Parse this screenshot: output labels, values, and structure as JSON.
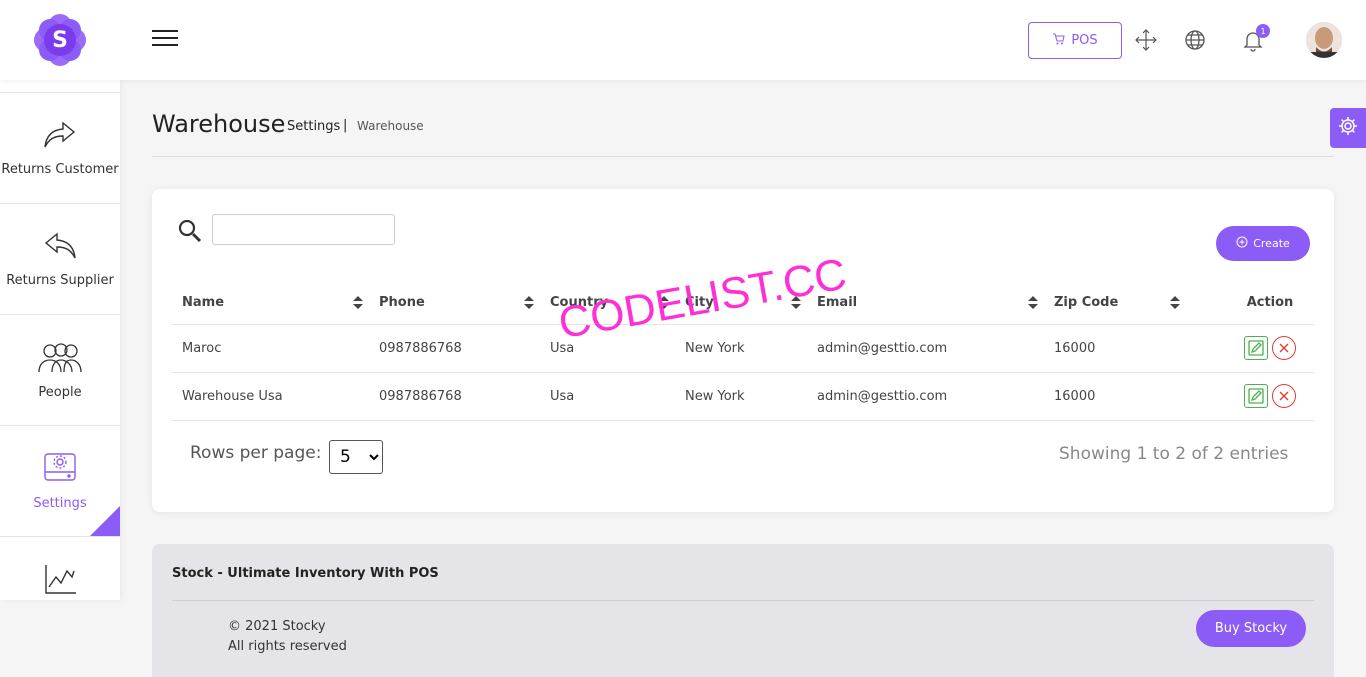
{
  "header": {
    "logo_letter": "S",
    "pos_label": "POS",
    "notification_count": "1"
  },
  "sidebar": {
    "items": [
      {
        "label": "Returns Customer",
        "icon": "share-forward-icon"
      },
      {
        "label": "Returns Supplier",
        "icon": "reply-back-icon"
      },
      {
        "label": "People",
        "icon": "people-icon"
      },
      {
        "label": "Settings",
        "icon": "settings-drive-icon",
        "active": true
      },
      {
        "label": "",
        "icon": "chart-line-icon"
      }
    ]
  },
  "page": {
    "title": "Warehouse",
    "breadcrumb_parent": "Settings",
    "breadcrumb_sep": "|",
    "breadcrumb_current": "Warehouse"
  },
  "toolbar": {
    "search_placeholder": "",
    "create_label": "Create"
  },
  "table": {
    "columns": [
      "Name",
      "Phone",
      "Country",
      "City",
      "Email",
      "Zip Code",
      "Action"
    ],
    "rows": [
      {
        "name": "Maroc",
        "phone": "0987886768",
        "country": "Usa",
        "city": "New York",
        "email": "admin@gesttio.com",
        "zip": "16000"
      },
      {
        "name": "Warehouse Usa",
        "phone": "0987886768",
        "country": "Usa",
        "city": "New York",
        "email": "admin@gesttio.com",
        "zip": "16000"
      }
    ]
  },
  "pagination": {
    "rows_per_page_label": "Rows per page:",
    "rows_per_page_value": "5",
    "showing_text": "Showing 1 to 2 of 2 entries"
  },
  "watermark": "CODELIST.CC",
  "footer": {
    "title": "Stock - Ultimate Inventory With POS",
    "copyright": "© 2021 Stocky",
    "rights": "All rights reserved",
    "buy_label": "Buy Stocky"
  },
  "colors": {
    "accent": "#8b5cf6",
    "edit": "#4caf50",
    "delete": "#e53935",
    "watermark": "#ff2fd6"
  }
}
